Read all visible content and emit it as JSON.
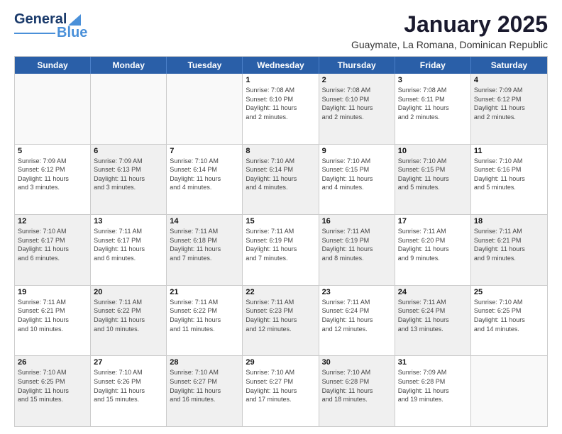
{
  "logo": {
    "line1": "General",
    "line2": "Blue"
  },
  "header": {
    "title": "January 2025",
    "subtitle": "Guaymate, La Romana, Dominican Republic"
  },
  "days": [
    "Sunday",
    "Monday",
    "Tuesday",
    "Wednesday",
    "Thursday",
    "Friday",
    "Saturday"
  ],
  "rows": [
    [
      {
        "day": "",
        "info": "",
        "shaded": false,
        "empty": true
      },
      {
        "day": "",
        "info": "",
        "shaded": false,
        "empty": true
      },
      {
        "day": "",
        "info": "",
        "shaded": false,
        "empty": true
      },
      {
        "day": "1",
        "info": "Sunrise: 7:08 AM\nSunset: 6:10 PM\nDaylight: 11 hours\nand 2 minutes.",
        "shaded": false,
        "empty": false
      },
      {
        "day": "2",
        "info": "Sunrise: 7:08 AM\nSunset: 6:10 PM\nDaylight: 11 hours\nand 2 minutes.",
        "shaded": true,
        "empty": false
      },
      {
        "day": "3",
        "info": "Sunrise: 7:08 AM\nSunset: 6:11 PM\nDaylight: 11 hours\nand 2 minutes.",
        "shaded": false,
        "empty": false
      },
      {
        "day": "4",
        "info": "Sunrise: 7:09 AM\nSunset: 6:12 PM\nDaylight: 11 hours\nand 2 minutes.",
        "shaded": true,
        "empty": false
      }
    ],
    [
      {
        "day": "5",
        "info": "Sunrise: 7:09 AM\nSunset: 6:12 PM\nDaylight: 11 hours\nand 3 minutes.",
        "shaded": false,
        "empty": false
      },
      {
        "day": "6",
        "info": "Sunrise: 7:09 AM\nSunset: 6:13 PM\nDaylight: 11 hours\nand 3 minutes.",
        "shaded": true,
        "empty": false
      },
      {
        "day": "7",
        "info": "Sunrise: 7:10 AM\nSunset: 6:14 PM\nDaylight: 11 hours\nand 4 minutes.",
        "shaded": false,
        "empty": false
      },
      {
        "day": "8",
        "info": "Sunrise: 7:10 AM\nSunset: 6:14 PM\nDaylight: 11 hours\nand 4 minutes.",
        "shaded": true,
        "empty": false
      },
      {
        "day": "9",
        "info": "Sunrise: 7:10 AM\nSunset: 6:15 PM\nDaylight: 11 hours\nand 4 minutes.",
        "shaded": false,
        "empty": false
      },
      {
        "day": "10",
        "info": "Sunrise: 7:10 AM\nSunset: 6:15 PM\nDaylight: 11 hours\nand 5 minutes.",
        "shaded": true,
        "empty": false
      },
      {
        "day": "11",
        "info": "Sunrise: 7:10 AM\nSunset: 6:16 PM\nDaylight: 11 hours\nand 5 minutes.",
        "shaded": false,
        "empty": false
      }
    ],
    [
      {
        "day": "12",
        "info": "Sunrise: 7:10 AM\nSunset: 6:17 PM\nDaylight: 11 hours\nand 6 minutes.",
        "shaded": true,
        "empty": false
      },
      {
        "day": "13",
        "info": "Sunrise: 7:11 AM\nSunset: 6:17 PM\nDaylight: 11 hours\nand 6 minutes.",
        "shaded": false,
        "empty": false
      },
      {
        "day": "14",
        "info": "Sunrise: 7:11 AM\nSunset: 6:18 PM\nDaylight: 11 hours\nand 7 minutes.",
        "shaded": true,
        "empty": false
      },
      {
        "day": "15",
        "info": "Sunrise: 7:11 AM\nSunset: 6:19 PM\nDaylight: 11 hours\nand 7 minutes.",
        "shaded": false,
        "empty": false
      },
      {
        "day": "16",
        "info": "Sunrise: 7:11 AM\nSunset: 6:19 PM\nDaylight: 11 hours\nand 8 minutes.",
        "shaded": true,
        "empty": false
      },
      {
        "day": "17",
        "info": "Sunrise: 7:11 AM\nSunset: 6:20 PM\nDaylight: 11 hours\nand 9 minutes.",
        "shaded": false,
        "empty": false
      },
      {
        "day": "18",
        "info": "Sunrise: 7:11 AM\nSunset: 6:21 PM\nDaylight: 11 hours\nand 9 minutes.",
        "shaded": true,
        "empty": false
      }
    ],
    [
      {
        "day": "19",
        "info": "Sunrise: 7:11 AM\nSunset: 6:21 PM\nDaylight: 11 hours\nand 10 minutes.",
        "shaded": false,
        "empty": false
      },
      {
        "day": "20",
        "info": "Sunrise: 7:11 AM\nSunset: 6:22 PM\nDaylight: 11 hours\nand 10 minutes.",
        "shaded": true,
        "empty": false
      },
      {
        "day": "21",
        "info": "Sunrise: 7:11 AM\nSunset: 6:22 PM\nDaylight: 11 hours\nand 11 minutes.",
        "shaded": false,
        "empty": false
      },
      {
        "day": "22",
        "info": "Sunrise: 7:11 AM\nSunset: 6:23 PM\nDaylight: 11 hours\nand 12 minutes.",
        "shaded": true,
        "empty": false
      },
      {
        "day": "23",
        "info": "Sunrise: 7:11 AM\nSunset: 6:24 PM\nDaylight: 11 hours\nand 12 minutes.",
        "shaded": false,
        "empty": false
      },
      {
        "day": "24",
        "info": "Sunrise: 7:11 AM\nSunset: 6:24 PM\nDaylight: 11 hours\nand 13 minutes.",
        "shaded": true,
        "empty": false
      },
      {
        "day": "25",
        "info": "Sunrise: 7:10 AM\nSunset: 6:25 PM\nDaylight: 11 hours\nand 14 minutes.",
        "shaded": false,
        "empty": false
      }
    ],
    [
      {
        "day": "26",
        "info": "Sunrise: 7:10 AM\nSunset: 6:25 PM\nDaylight: 11 hours\nand 15 minutes.",
        "shaded": true,
        "empty": false
      },
      {
        "day": "27",
        "info": "Sunrise: 7:10 AM\nSunset: 6:26 PM\nDaylight: 11 hours\nand 15 minutes.",
        "shaded": false,
        "empty": false
      },
      {
        "day": "28",
        "info": "Sunrise: 7:10 AM\nSunset: 6:27 PM\nDaylight: 11 hours\nand 16 minutes.",
        "shaded": true,
        "empty": false
      },
      {
        "day": "29",
        "info": "Sunrise: 7:10 AM\nSunset: 6:27 PM\nDaylight: 11 hours\nand 17 minutes.",
        "shaded": false,
        "empty": false
      },
      {
        "day": "30",
        "info": "Sunrise: 7:10 AM\nSunset: 6:28 PM\nDaylight: 11 hours\nand 18 minutes.",
        "shaded": true,
        "empty": false
      },
      {
        "day": "31",
        "info": "Sunrise: 7:09 AM\nSunset: 6:28 PM\nDaylight: 11 hours\nand 19 minutes.",
        "shaded": false,
        "empty": false
      },
      {
        "day": "",
        "info": "",
        "shaded": false,
        "empty": true
      }
    ]
  ]
}
